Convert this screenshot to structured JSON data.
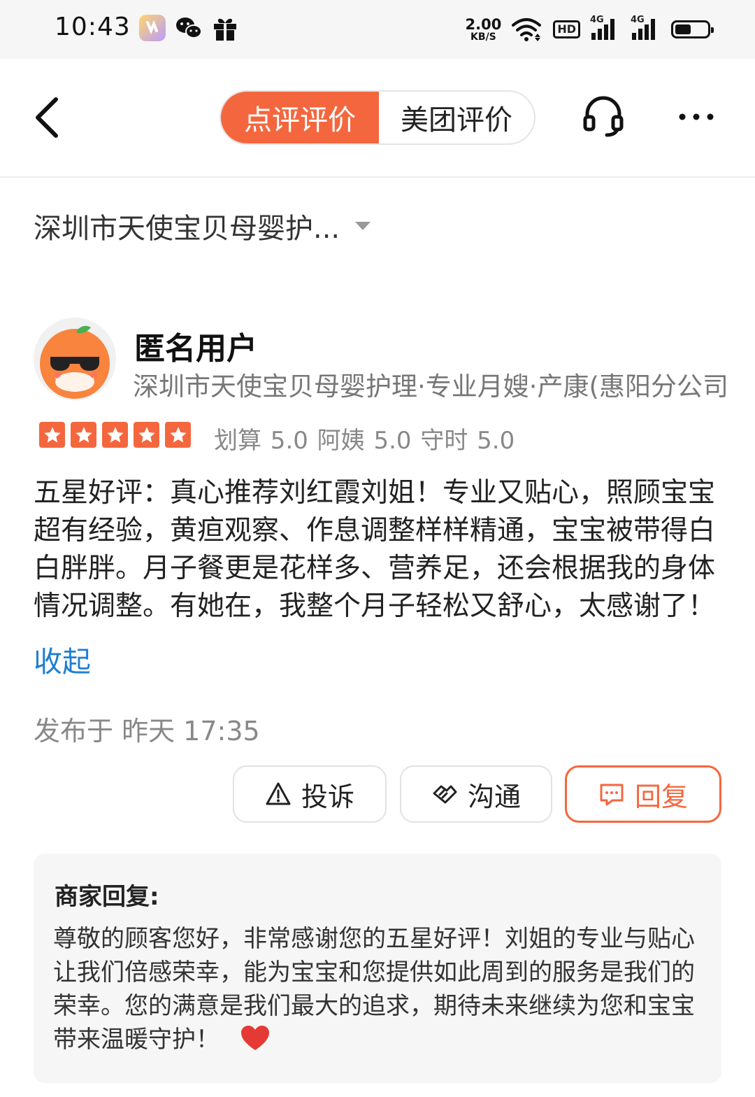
{
  "status_bar": {
    "time": "10:43",
    "net_speed": "2.00",
    "net_unit": "KB/S",
    "hd_label": "HD",
    "signal_1_label": "4G",
    "signal_2_label": "4G"
  },
  "nav": {
    "tabs": [
      {
        "label": "点评评价",
        "active": true
      },
      {
        "label": "美团评价",
        "active": false
      }
    ],
    "accent": "#f4673e",
    "icons": [
      "back-arrow-icon",
      "customer-service-icon",
      "more-icon"
    ]
  },
  "shop_selector": {
    "label": "深圳市天使宝贝母婴护..."
  },
  "review": {
    "user_name": "匿名用户",
    "shop_full": "深圳市天使宝贝母婴护理·专业月嫂·产康(惠阳分公司",
    "star_rating": 5,
    "scores": "划算 5.0 阿姨 5.0 守时 5.0",
    "content": "五星好评：真心推荐刘红霞刘姐！专业又贴心，照顾宝宝超有经验，黄疸观察、作息调整样样精通，宝宝被带得白白胖胖。月子餐更是花样多、营养足，还会根据我的身体情况调整。有她在，我整个月子轻松又舒心，太感谢了！",
    "collapse_label": "收起",
    "published": "发布于 昨天 17:35"
  },
  "actions": {
    "complain_label": "投诉",
    "communicate_label": "沟通",
    "reply_label": "回复"
  },
  "merchant_reply": {
    "title": "商家回复:",
    "body": "尊敬的顾客您好，非常感谢您的五星好评！刘姐的专业与贴心让我们倍感荣幸，能为宝宝和您提供如此周到的服务是我们的荣幸。您的满意是我们最大的追求，期待未来继续为您和宝宝带来温暖守护！"
  }
}
